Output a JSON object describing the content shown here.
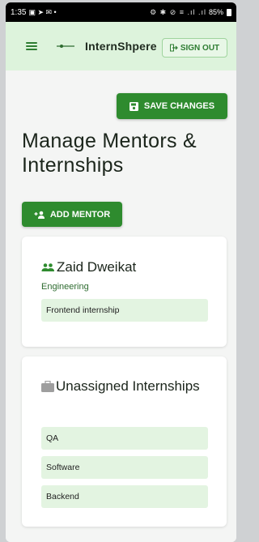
{
  "statusbar": {
    "time": "1:35",
    "left_icons": "▣ ➤ ✉ •",
    "right_icons": "⚙ ✱ ⊘ ≡ .ıl .ıl",
    "battery": "85%"
  },
  "appbar": {
    "title": "InternShpere",
    "signout_label": "SIGN OUT"
  },
  "toolbar": {
    "save_label": "SAVE CHANGES",
    "add_mentor_label": "ADD MENTOR"
  },
  "page": {
    "title": "Manage Mentors & Internships"
  },
  "mentors": [
    {
      "name": "Zaid Dweikat",
      "department": "Engineering",
      "internships": [
        "Frontend internship"
      ]
    }
  ],
  "unassigned": {
    "title": "Unassigned Internships",
    "internships": [
      "QA",
      "Software",
      "Backend"
    ]
  },
  "colors": {
    "primary": "#2e8b2e",
    "appbar_bg": "#ddf3dc",
    "chip_bg": "#e3f4e1"
  }
}
